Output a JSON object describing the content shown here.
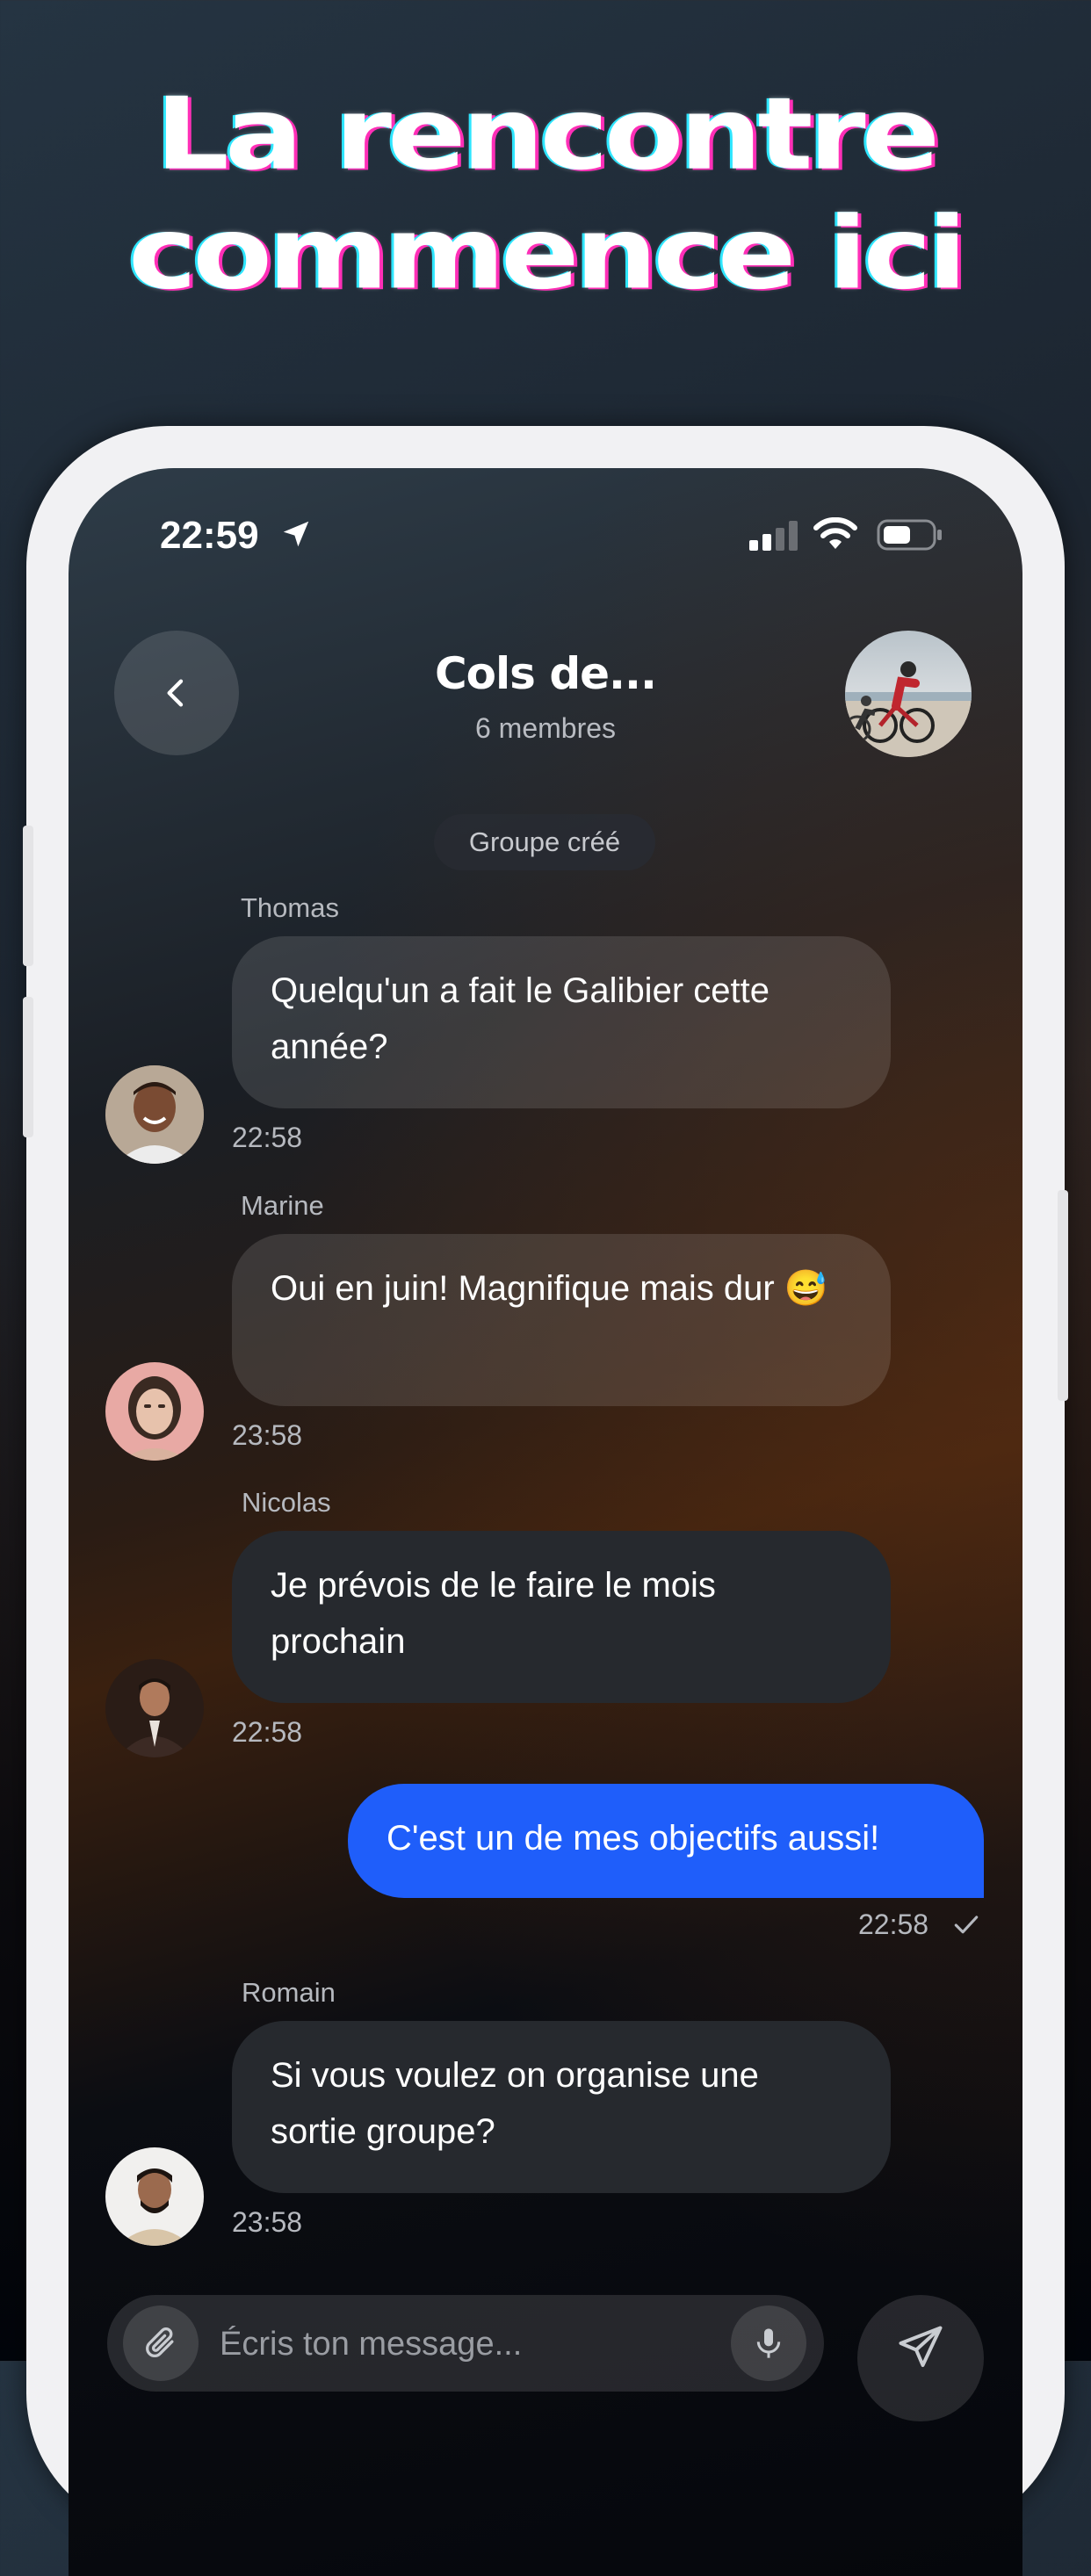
{
  "headline": {
    "line1": "La rencontre",
    "line2": "commence ici"
  },
  "status_bar": {
    "time": "22:59",
    "icons": [
      "location-arrow-icon",
      "cellular-signal-icon",
      "wifi-icon",
      "battery-icon"
    ]
  },
  "chat_header": {
    "title": "Cols de...",
    "subtitle": "6 membres",
    "back_icon": "chevron-left-icon",
    "group_avatar": "cyclists-photo"
  },
  "system_message": "Groupe créé",
  "messages": [
    {
      "sender": "Thomas",
      "text": "Quelqu'un a fait le Galibier cette année?",
      "time": "22:58"
    },
    {
      "sender": "Marine",
      "text": "Oui en juin! Magnifique mais dur 😅",
      "time": "23:58"
    },
    {
      "sender": "Nicolas",
      "text": "Je prévois de le faire le mois prochain",
      "time": "22:58"
    },
    {
      "sender": "",
      "text": "C'est un de mes objectifs aussi!",
      "time": "22:58",
      "outgoing": true,
      "status_icon": "check-icon"
    },
    {
      "sender": "Romain",
      "text": "Si vous voulez on organise une sortie groupe?",
      "time": "23:58"
    }
  ],
  "composer": {
    "placeholder": "Écris ton message...",
    "icons": [
      "paperclip-icon",
      "microphone-icon",
      "send-icon"
    ]
  },
  "colors": {
    "outgoing_bubble": "#1f5efa",
    "incoming_bubble": "#2a2d32",
    "headline_outline_cyan": "#2ee6ff",
    "headline_outline_magenta": "#ff2fb7"
  }
}
